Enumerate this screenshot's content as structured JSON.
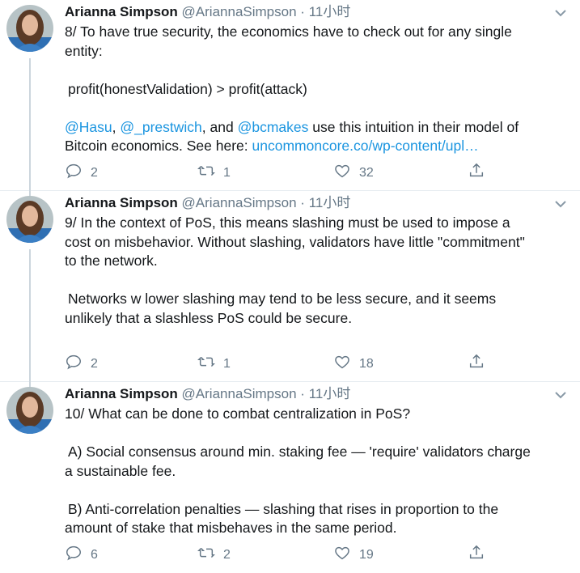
{
  "tweets": [
    {
      "author": "Arianna Simpson",
      "handle": "@AriannaSimpson",
      "dot": "·",
      "time": "11小时",
      "lines": [
        {
          "text": "8/ To have true security, the economics have to check out for any single"
        },
        {
          "text": "entity:"
        },
        {
          "gap": true
        },
        {
          "text": "profit(honestValidation) > profit(attack)",
          "indent": true
        },
        {
          "gap": true
        },
        {
          "links_line_a": true
        },
        {
          "links_line_b": true
        }
      ],
      "mentions": [
        "@Hasu",
        "@_prestwich",
        "@bcmakes"
      ],
      "mention_sep_1": ", ",
      "mention_sep_2": ", and ",
      "mention_tail": " use this intuition in their model of",
      "line_b_prefix": "Bitcoin economics. See here: ",
      "link_url": "uncommoncore.co/wp-content/upl…",
      "replies": "2",
      "retweets": "1",
      "likes": "32"
    },
    {
      "author": "Arianna Simpson",
      "handle": "@AriannaSimpson",
      "dot": "·",
      "time": "11小时",
      "lines": [
        {
          "text": "9/ In the context of PoS, this means slashing must be used to impose a"
        },
        {
          "text": "cost on misbehavior. Without slashing, validators have little \"commitment\""
        },
        {
          "text": "to the network."
        },
        {
          "gap": true
        },
        {
          "text": "Networks w lower slashing may tend to be less secure, and it seems",
          "indent": true
        },
        {
          "text": "unlikely that a slashless PoS could be secure."
        }
      ],
      "replies": "2",
      "retweets": "1",
      "likes": "18"
    },
    {
      "author": "Arianna Simpson",
      "handle": "@AriannaSimpson",
      "dot": "·",
      "time": "11小时",
      "lines": [
        {
          "text": "10/ What can be done to combat centralization in PoS?"
        },
        {
          "gap": true
        },
        {
          "text": "A) Social consensus around min. staking fee — 'require' validators charge",
          "indent": true
        },
        {
          "text": "a sustainable fee."
        },
        {
          "gap": true
        },
        {
          "text": "B) Anti-correlation penalties — slashing that rises in proportion to the",
          "indent": true
        },
        {
          "text": "amount of stake that misbehaves in the same period."
        }
      ],
      "replies": "6",
      "retweets": "2",
      "likes": "19"
    }
  ],
  "colors": {
    "link": "#1b95e0",
    "muted": "#657786",
    "text": "#14171a",
    "thread_line": "#ccd6dd"
  },
  "icons": {
    "reply": "reply-icon",
    "retweet": "retweet-icon",
    "like": "heart-icon",
    "share": "share-icon",
    "menu": "chevron-down-icon"
  }
}
